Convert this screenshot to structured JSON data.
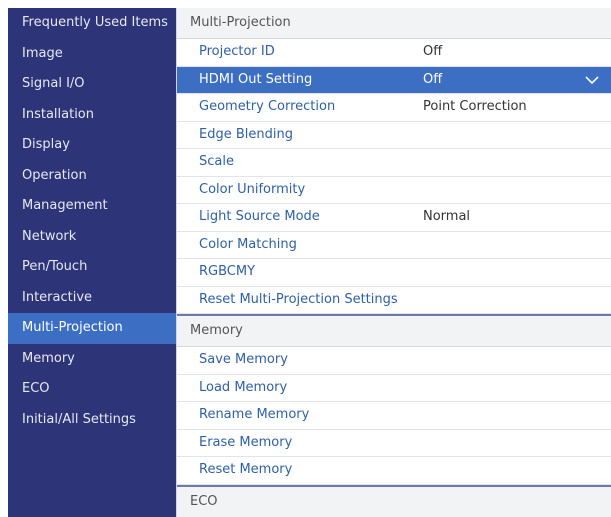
{
  "sidebar": {
    "items": [
      {
        "label": "Frequently Used Items",
        "active": false
      },
      {
        "label": "Image",
        "active": false
      },
      {
        "label": "Signal I/O",
        "active": false
      },
      {
        "label": "Installation",
        "active": false
      },
      {
        "label": "Display",
        "active": false
      },
      {
        "label": "Operation",
        "active": false
      },
      {
        "label": "Management",
        "active": false
      },
      {
        "label": "Network",
        "active": false
      },
      {
        "label": "Pen/Touch",
        "active": false
      },
      {
        "label": "Interactive",
        "active": false
      },
      {
        "label": "Multi-Projection",
        "active": true
      },
      {
        "label": "Memory",
        "active": false
      },
      {
        "label": "ECO",
        "active": false
      },
      {
        "label": "Initial/All Settings",
        "active": false
      }
    ]
  },
  "main": {
    "sections": [
      {
        "header": "Multi-Projection",
        "rows": [
          {
            "label": "Projector ID",
            "value": "Off"
          },
          {
            "label": "HDMI Out Setting",
            "value": "Off",
            "selected": true,
            "icon": "chevron-down-icon"
          },
          {
            "label": "Geometry Correction",
            "value": "Point Correction"
          },
          {
            "label": "Edge Blending",
            "value": ""
          },
          {
            "label": "Scale",
            "value": ""
          },
          {
            "label": "Color Uniformity",
            "value": ""
          },
          {
            "label": "Light Source Mode",
            "value": "Normal"
          },
          {
            "label": "Color Matching",
            "value": ""
          },
          {
            "label": "RGBCMY",
            "value": ""
          },
          {
            "label": "Reset Multi-Projection Settings",
            "value": ""
          }
        ]
      },
      {
        "header": "Memory",
        "rows": [
          {
            "label": "Save Memory",
            "value": ""
          },
          {
            "label": "Load Memory",
            "value": ""
          },
          {
            "label": "Rename Memory",
            "value": ""
          },
          {
            "label": "Erase Memory",
            "value": ""
          },
          {
            "label": "Reset Memory",
            "value": ""
          }
        ]
      },
      {
        "header": "ECO",
        "rows": []
      }
    ]
  },
  "colors": {
    "sidebar_bg": "#2d3477",
    "selected_bg": "#3c6ec4",
    "link_text": "#2f5fa8"
  }
}
